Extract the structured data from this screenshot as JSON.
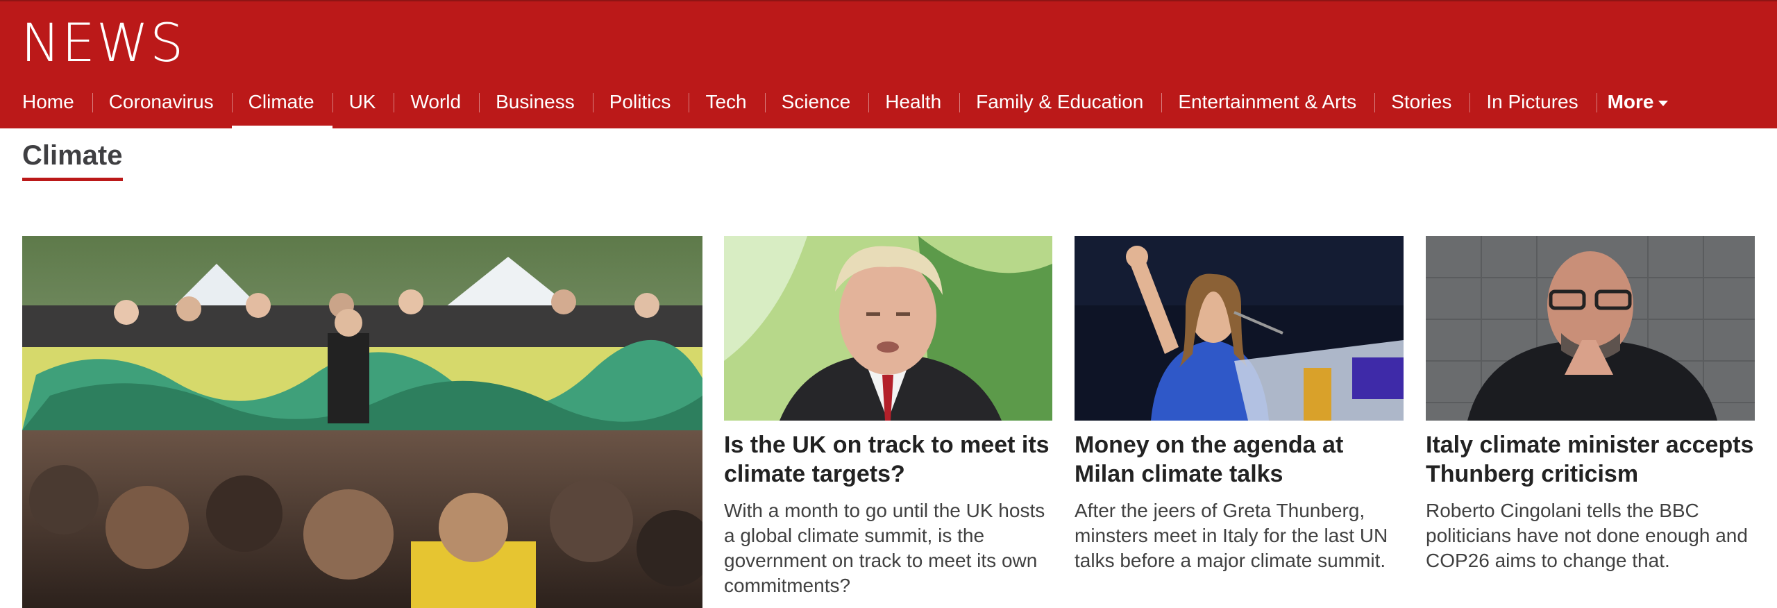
{
  "header": {
    "logo_text": "NEWS",
    "background_color": "#bb1919",
    "nav": [
      {
        "label": "Home"
      },
      {
        "label": "Coronavirus"
      },
      {
        "label": "Climate",
        "active": true
      },
      {
        "label": "UK"
      },
      {
        "label": "World"
      },
      {
        "label": "Business"
      },
      {
        "label": "Politics"
      },
      {
        "label": "Tech"
      },
      {
        "label": "Science"
      },
      {
        "label": "Health"
      },
      {
        "label": "Family & Education"
      },
      {
        "label": "Entertainment & Arts"
      },
      {
        "label": "Stories"
      },
      {
        "label": "In Pictures"
      }
    ],
    "more_label": "More",
    "more_icon": "caret-down-icon"
  },
  "section": {
    "title": "Climate",
    "accent_color": "#bb1919"
  },
  "stories": [
    {
      "image_desc": "climate-protest-crowd-photo"
    },
    {
      "image_desc": "politician-portrait-photo",
      "headline": "Is the UK on track to meet its climate targets?",
      "summary": "With a month to go until the UK hosts a global climate summit, is the government on track to meet its own commitments?"
    },
    {
      "image_desc": "activist-speaking-at-podium-photo",
      "headline": "Money on the agenda at Milan climate talks",
      "summary": "After the jeers of Greta Thunberg, minsters meet in Italy for the last UN talks before a major climate summit."
    },
    {
      "image_desc": "minister-speaking-photo",
      "headline": "Italy climate minister accepts Thunberg criticism",
      "summary": "Roberto Cingolani tells the BBC politicians have not done enough and COP26 aims to change that."
    }
  ]
}
